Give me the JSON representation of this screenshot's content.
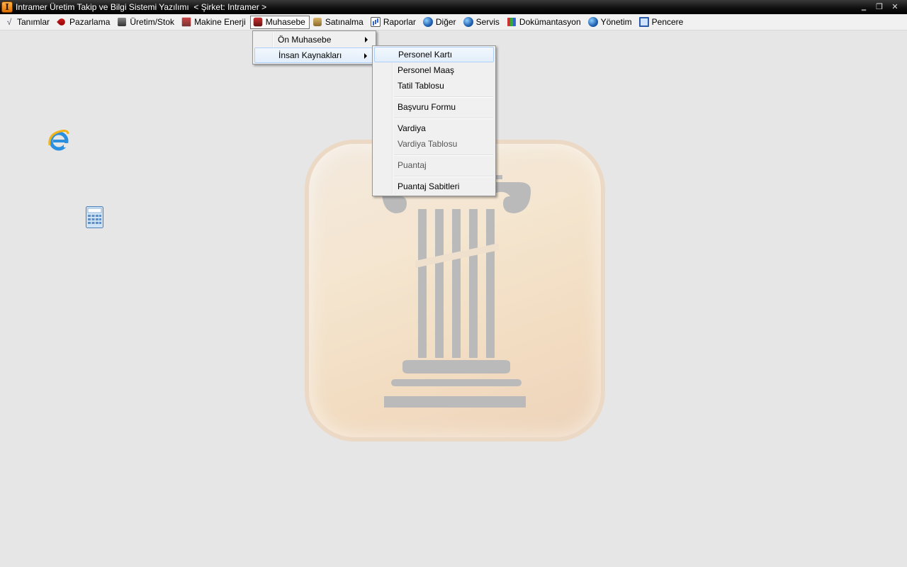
{
  "window": {
    "title": "Intramer Üretim Takip ve Bilgi Sistemi Yazılımı  < Şirket: Intramer >",
    "minimize_glyph": "‗",
    "restore_glyph": "❐",
    "close_glyph": "✕"
  },
  "menubar": {
    "items": [
      {
        "label": "Tanımlar",
        "icon": "check-icon"
      },
      {
        "label": "Pazarlama",
        "icon": "pin-icon"
      },
      {
        "label": "Üretim/Stok",
        "icon": "box-icon"
      },
      {
        "label": "Makine Enerji",
        "icon": "machine-icon"
      },
      {
        "label": "Muhasebe",
        "icon": "calculator-icon"
      },
      {
        "label": "Satınalma",
        "icon": "cart-icon"
      },
      {
        "label": "Raporlar",
        "icon": "chart-icon"
      },
      {
        "label": "Diğer",
        "icon": "globe-icon"
      },
      {
        "label": "Servis",
        "icon": "globe-icon"
      },
      {
        "label": "Dokümantasyon",
        "icon": "books-icon"
      },
      {
        "label": "Yönetim",
        "icon": "globe-icon"
      },
      {
        "label": "Pencere",
        "icon": "window-icon"
      }
    ]
  },
  "muhasebe_menu": {
    "items": [
      {
        "label": "Ön Muhasebe"
      },
      {
        "label": "İnsan Kaynakları"
      }
    ]
  },
  "hr_menu": {
    "items": [
      {
        "label": "Personel Kartı"
      },
      {
        "label": "Personel Maaş"
      },
      {
        "label": "Tatil Tablosu"
      },
      {
        "label": "Başvuru Formu"
      },
      {
        "label": "Vardiya"
      },
      {
        "label": "Vardiya Tablosu"
      },
      {
        "label": "Puantaj"
      },
      {
        "label": "Puantaj Sabitleri"
      }
    ]
  },
  "colors": {
    "titlebar": "#111111",
    "menubar": "#f1f1f1",
    "desktop": "#e6e6e6",
    "logo_tile": "#f3dcc0",
    "column": "#b9b9b9"
  }
}
